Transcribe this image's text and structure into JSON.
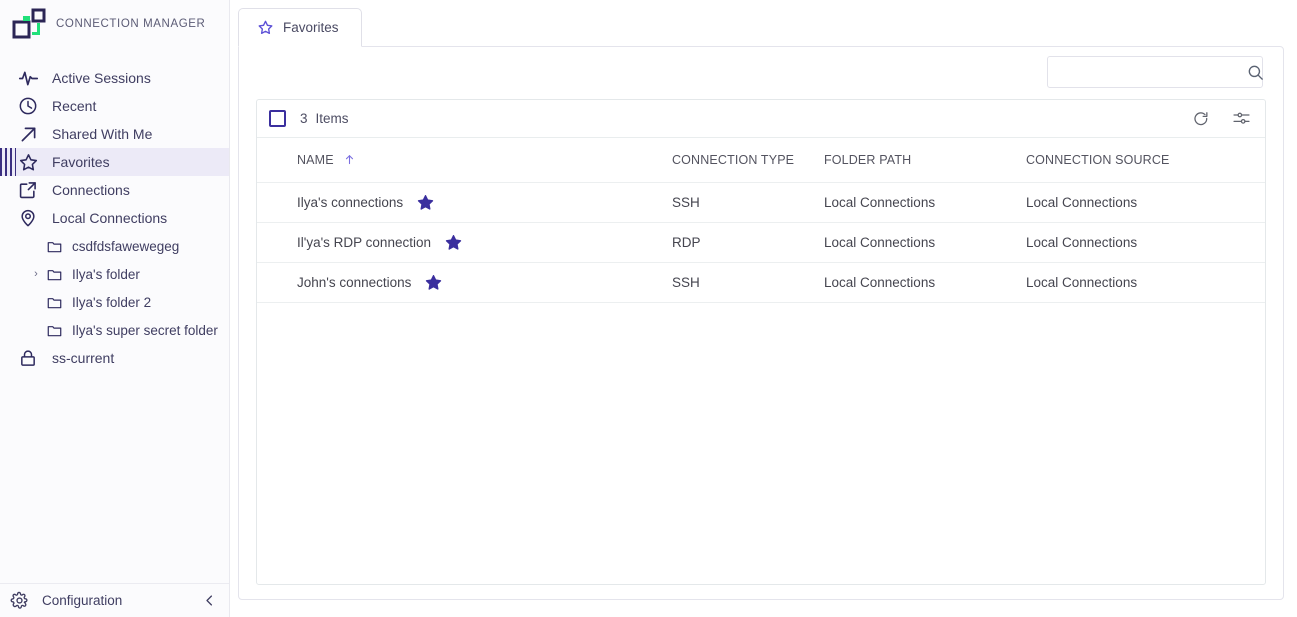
{
  "brand": {
    "title": "CONNECTION MANAGER",
    "logo_icon": "connection-manager-logo"
  },
  "sidebar": {
    "items": [
      {
        "label": "Active Sessions",
        "icon": "activity-pulse-icon",
        "active": false
      },
      {
        "label": "Recent",
        "icon": "clock-icon",
        "active": false
      },
      {
        "label": "Shared With Me",
        "icon": "arrow-up-right-icon",
        "active": false
      },
      {
        "label": "Favorites",
        "icon": "star-outline-icon",
        "active": true
      },
      {
        "label": "Connections",
        "icon": "external-link-icon",
        "active": false
      },
      {
        "label": "Local Connections",
        "icon": "location-pin-icon",
        "active": false
      }
    ],
    "folders": [
      {
        "label": "csdfdsfawewegeg",
        "icon": "folder-icon",
        "expandable": false
      },
      {
        "label": "Ilya's folder",
        "icon": "folder-icon",
        "expandable": true
      },
      {
        "label": "Ilya's folder 2",
        "icon": "folder-icon",
        "expandable": false
      },
      {
        "label": "Ilya's super secret folder",
        "icon": "folder-icon",
        "expandable": false
      }
    ],
    "vault": {
      "label": "ss-current",
      "icon": "lock-icon"
    },
    "footer": {
      "label": "Configuration",
      "gear_icon": "gear-icon",
      "collapse_icon": "chevron-left-icon"
    }
  },
  "tabs": [
    {
      "label": "Favorites",
      "icon": "star-outline-icon",
      "active": true
    }
  ],
  "search": {
    "value": "",
    "placeholder": "",
    "icon": "search-icon"
  },
  "toolbar": {
    "select_all_checked": false,
    "count": "3",
    "count_label": "Items",
    "refresh_icon": "refresh-icon",
    "settings_icon": "sliders-settings-icon"
  },
  "table": {
    "columns": [
      {
        "label": "NAME",
        "sorted": true,
        "sort_icon": "sort-arrow-up-icon"
      },
      {
        "label": "CONNECTION TYPE",
        "sorted": false
      },
      {
        "label": "FOLDER PATH",
        "sorted": false
      },
      {
        "label": "CONNECTION SOURCE",
        "sorted": false
      }
    ],
    "rows": [
      {
        "name": "Ilya's connections",
        "favorite_icon": "star-filled-icon",
        "connection_type": "SSH",
        "folder_path": "Local Connections",
        "connection_source": "Local Connections"
      },
      {
        "name": "Il'ya's RDP connection",
        "favorite_icon": "star-filled-icon",
        "connection_type": "RDP",
        "folder_path": "Local Connections",
        "connection_source": "Local Connections"
      },
      {
        "name": "John's connections",
        "favorite_icon": "star-filled-icon",
        "connection_type": "SSH",
        "folder_path": "Local Connections",
        "connection_source": "Local Connections"
      }
    ]
  },
  "colors": {
    "accent_purple": "#3b2f9e",
    "accent_light_purple": "#5b4fd6",
    "active_bg": "#eceaf7",
    "logo_green": "#21e07a",
    "logo_navy": "#2b2555",
    "text_primary": "#3f3d61",
    "border": "#e4e8ea"
  }
}
